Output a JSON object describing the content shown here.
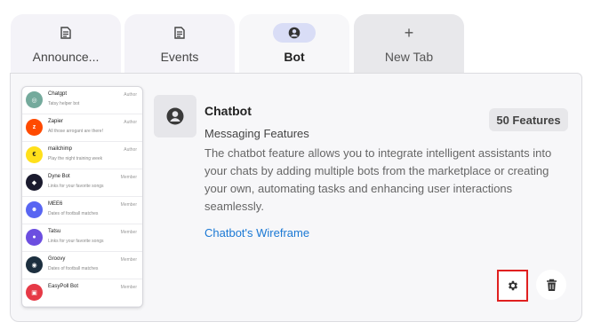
{
  "tabs": [
    {
      "label": "Announce..."
    },
    {
      "label": "Events"
    },
    {
      "label": "Bot"
    },
    {
      "label": "New Tab"
    }
  ],
  "preview": {
    "items": [
      {
        "name": "Chatgpt",
        "sub": "Tatsy helper bot",
        "role": "Author",
        "color": "#74aa9c"
      },
      {
        "name": "Zapier",
        "sub": "All those arrogant are there!",
        "role": "Author",
        "color": "#ff4a00"
      },
      {
        "name": "mailchimp",
        "sub": "Play the night training week",
        "role": "Author",
        "color": "#ffe01b"
      },
      {
        "name": "Dyne Bot",
        "sub": "Links for your favorite songs",
        "role": "Member",
        "color": "#1a1a2e"
      },
      {
        "name": "MEE6",
        "sub": "Dates of football matches",
        "role": "Member",
        "color": "#5865f2"
      },
      {
        "name": "Tatsu",
        "sub": "Links for your favorite songs",
        "role": "Member",
        "color": "#6c4ee0"
      },
      {
        "name": "Groovy",
        "sub": "Dates of football matches",
        "role": "Member",
        "color": "#1c2f3f"
      },
      {
        "name": "EasyPoll Bot",
        "sub": "",
        "role": "Member",
        "color": "#e63946"
      }
    ]
  },
  "bot": {
    "title": "Chatbot",
    "subtitle": "Messaging Features",
    "description": "The chatbot feature allows you to integrate intelligent assistants into your chats by adding multiple bots from the marketplace or creating your own, automating tasks and enhancing user interactions seamlessly.",
    "link": "Chatbot's Wireframe",
    "badge": "50 Features"
  },
  "icons": {
    "tab_doc": "document-icon",
    "tab_bot": "user-circle-icon",
    "tab_new": "plus-icon",
    "settings": "gear-icon",
    "delete": "trash-icon"
  }
}
